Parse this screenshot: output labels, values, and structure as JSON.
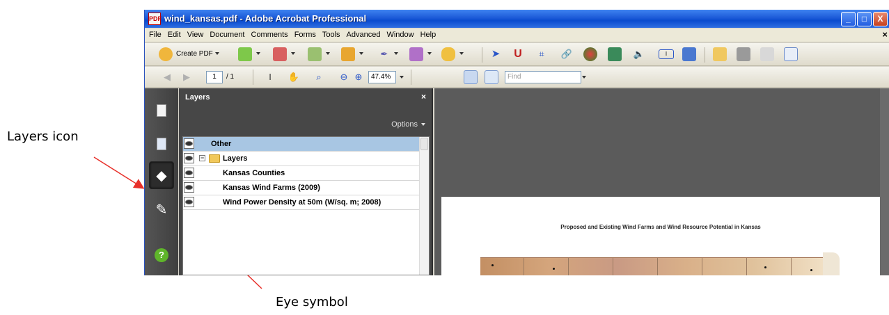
{
  "window": {
    "title": "wind_kansas.pdf - Adobe Acrobat Professional",
    "app_icon": "pdf-file-icon",
    "controls": {
      "minimize": "_",
      "maximize": "□",
      "close": "X"
    }
  },
  "menubar": {
    "items": [
      "File",
      "Edit",
      "View",
      "Document",
      "Comments",
      "Forms",
      "Tools",
      "Advanced",
      "Window",
      "Help"
    ],
    "close_glyph": "×"
  },
  "toolbar1": {
    "create_pdf_label": "Create PDF",
    "icons": [
      "create-pdf-icon",
      "combine-files-icon",
      "export-icon",
      "review-icon",
      "secure-lock-icon",
      "sign-pen-icon",
      "forms-icon",
      "comment-icon",
      "select-arrow-icon",
      "pan-tool-icon",
      "crop-icon",
      "link-icon",
      "3d-object-icon",
      "video-icon",
      "sound-icon",
      "text-field-icon",
      "edit-icon",
      "open-folder-icon",
      "print-icon",
      "attach-icon",
      "email-icon"
    ]
  },
  "toolbar2": {
    "page_current": "1",
    "page_total": "/ 1",
    "zoom": "47.4%",
    "find_placeholder": "Find"
  },
  "left_tabs": [
    "pages-icon",
    "attachments-icon",
    "layers-icon",
    "signatures-icon",
    "help-icon"
  ],
  "layers_panel": {
    "title": "Layers",
    "close_glyph": "×",
    "options_label": "Options",
    "rows": [
      {
        "name": "Other",
        "selected": true
      },
      {
        "name": "Layers",
        "folder": true,
        "expander": "−"
      },
      {
        "name": "Kansas Counties"
      },
      {
        "name": "Kansas Wind Farms (2009)"
      },
      {
        "name": "Wind Power Density at 50m (W/sq. m; 2008)"
      }
    ]
  },
  "document": {
    "page_title": "Proposed and Existing Wind Farms and Wind Resource Potential in Kansas"
  },
  "callouts": {
    "layers_icon": "Layers icon",
    "eye_symbol": "Eye symbol"
  },
  "colors": {
    "titlebar": "#0a4bce",
    "panel": "#474747",
    "selected_row": "#a8c6e3",
    "doc_background": "#5b5b5b",
    "arrow": "#e8302a"
  }
}
